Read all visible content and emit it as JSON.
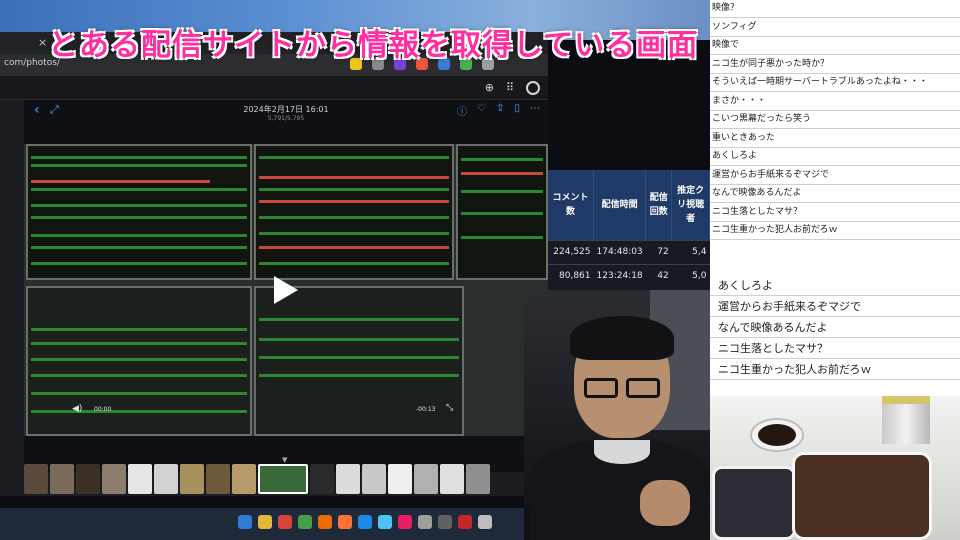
{
  "caption": {
    "text": "とある配信サイトから情報を取得している画面",
    "color": "#ff2fa1"
  },
  "browser": {
    "url": "com/photos/",
    "tab_close_glyph": "×",
    "tab_new_glyph": "+"
  },
  "photo_viewer": {
    "title": "2024年2月17日 16:01",
    "subtitle": "5,791/5,795",
    "time_elapsed": "00:00",
    "time_remaining": "-00:13"
  },
  "stats_table": {
    "headers": [
      "コメント数",
      "配信時間",
      "配信回数",
      "推定クリ視聴者"
    ],
    "rows": [
      [
        "224,525",
        "174:48:03",
        "72",
        "5,4"
      ],
      [
        "80,861",
        "123:24:18",
        "42",
        "5,0"
      ]
    ]
  },
  "comments_top": [
    "映像？",
    "ソンフィグ",
    "映像で",
    "ニコ生が同子悪かった時か？",
    "そういえば一時期サーバートラブルあったよね・・・",
    "まさか・・・",
    "こいつ黒幕だったら笑う",
    "重いときあった",
    "あくしろよ",
    "運営からお手紙来るぞマジで",
    "なんで映像あるんだよ",
    "ニコ生落としたマサ？",
    "ニコ生重かった犯人お前だろｗ"
  ],
  "comments_mid": [
    "あくしろよ",
    "運営からお手紙来るぞマジで",
    "なんで映像あるんだよ",
    "ニコ生落としたマサ？",
    "ニコ生重かった犯人お前だろｗ"
  ],
  "icons": {
    "back": "chevron-left-icon",
    "expand": "expand-icon",
    "info": "info-icon",
    "favorite": "heart-icon",
    "share": "upload-icon",
    "delete": "trash-icon",
    "more": "more-icon",
    "play": "play-icon",
    "volume": "volume-icon"
  }
}
